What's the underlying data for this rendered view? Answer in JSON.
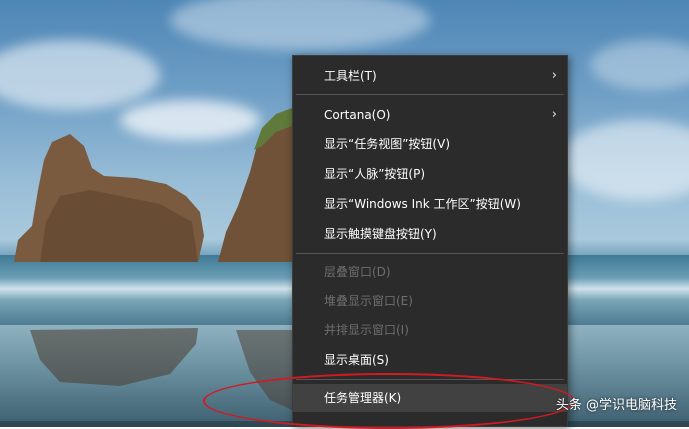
{
  "context_menu": {
    "items": [
      {
        "label": "工具栏(T)",
        "submenu": true,
        "enabled": true
      },
      {
        "label": "Cortana(O)",
        "submenu": true,
        "enabled": true
      },
      {
        "label": "显示“任务视图”按钮(V)",
        "enabled": true
      },
      {
        "label": "显示“人脉”按钮(P)",
        "enabled": true
      },
      {
        "label": "显示“Windows Ink 工作区”按钮(W)",
        "enabled": true
      },
      {
        "label": "显示触摸键盘按钮(Y)",
        "enabled": true
      },
      {
        "label": "层叠窗口(D)",
        "enabled": false
      },
      {
        "label": "堆叠显示窗口(E)",
        "enabled": false
      },
      {
        "label": "并排显示窗口(I)",
        "enabled": false
      },
      {
        "label": "显示桌面(S)",
        "enabled": true
      },
      {
        "label": "任务管理器(K)",
        "enabled": true,
        "highlighted": true
      }
    ],
    "submenu_arrow": "›"
  },
  "watermark": "头条 @学识电脑科技",
  "colors": {
    "menu_background": "#2b2b2b",
    "menu_text": "#ffffff",
    "menu_disabled_text": "#6e6e6e",
    "highlight_ellipse": "#d21a23"
  },
  "icons": [
    "chevron-right-icon"
  ]
}
